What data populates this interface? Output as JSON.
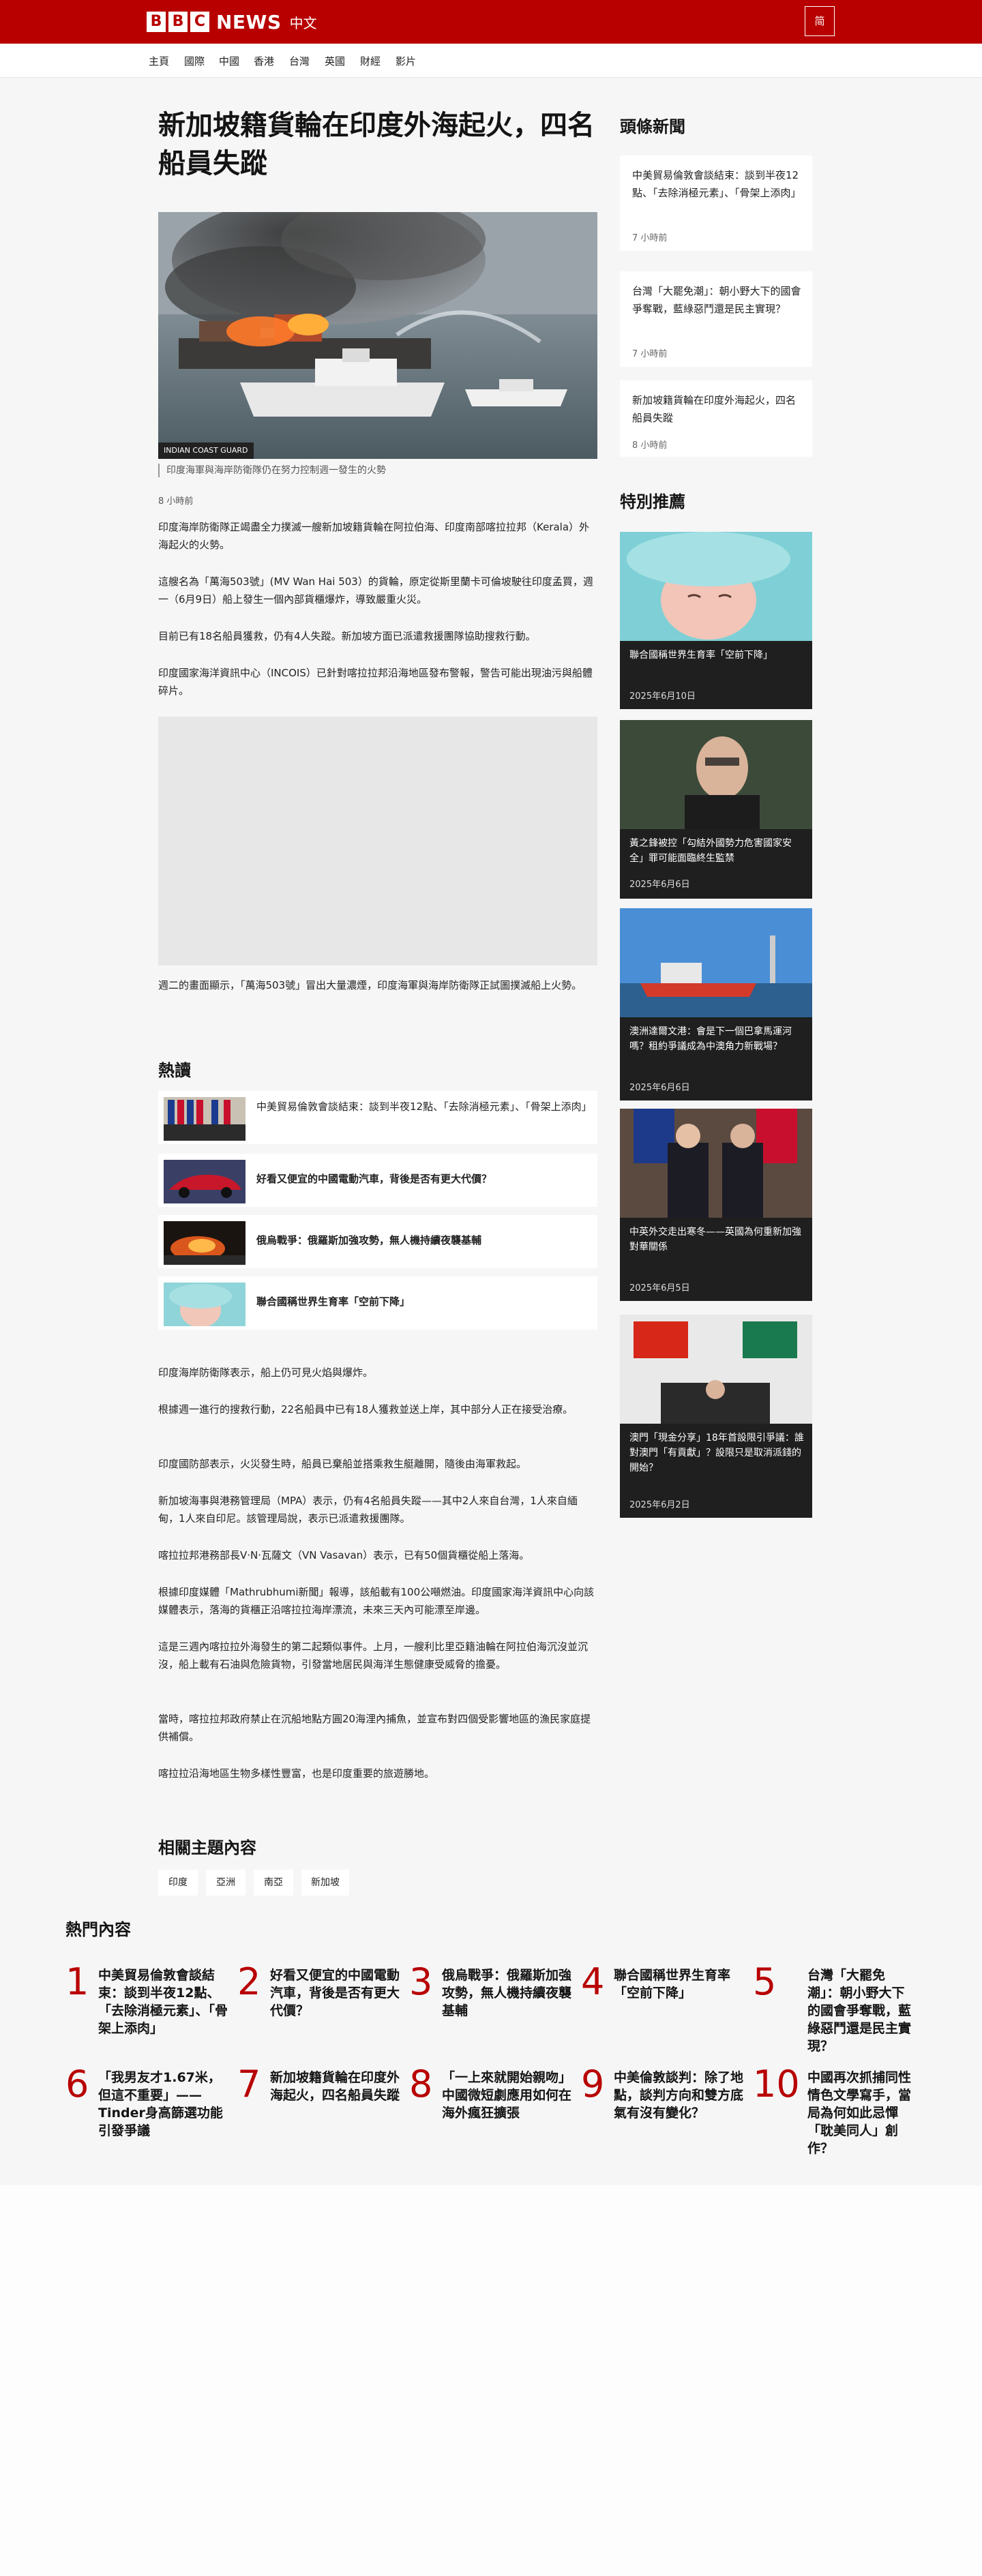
{
  "header": {
    "logo_letters": [
      "B",
      "B",
      "C"
    ],
    "brand": "NEWS",
    "brand_sub": "中文",
    "lang_toggle": "简"
  },
  "nav": [
    "主頁",
    "國際",
    "中國",
    "香港",
    "台灣",
    "英國",
    "財經",
    "影片"
  ],
  "article": {
    "title": "新加坡籍貨輪在印度外海起火，四名船員失蹤",
    "image_credit": "INDIAN COAST GUARD",
    "image_caption": "印度海軍與海岸防衛隊仍在努力控制週一發生的火勢",
    "time": "8 小時前",
    "paragraphs_top": [
      "印度海岸防衛隊正竭盡全力撲滅一艘新加坡籍貨輪在阿拉伯海、印度南部喀拉拉邦（Kerala）外海起火的火勢。",
      "這艘名為「萬海503號」(MV Wan Hai 503）的貨輪，原定從斯里蘭卡可倫坡駛往印度孟買，週一（6月9日）船上發生一個內部貨櫃爆炸，導致嚴重火災。",
      "目前已有18名船員獲救，仍有4人失蹤。新加坡方面已派遣救援團隊協助搜救行動。",
      "印度國家海洋資訊中心（INCOIS）已針對喀拉拉邦沿海地區發布警報，警告可能出現油污與船體碎片。"
    ],
    "video_caption": "週二的畫面顯示，「萬海503號」冒出大量濃煙，印度海軍與海岸防衛隊正試圖撲滅船上火勢。",
    "paragraphs_bottom": [
      "印度海岸防衛隊表示，船上仍可見火焰與爆炸。",
      "根據週一進行的搜救行動，22名船員中已有18人獲救並送上岸，其中部分人正在接受治療。",
      "印度國防部表示，火災發生時，船員已棄船並搭乘救生艇離開，隨後由海軍救起。",
      "新加坡海事與港務管理局（MPA）表示，仍有4名船員失蹤——其中2人來自台灣，1人來自緬甸，1人來自印尼。該管理局說，表示已派遣救援團隊。",
      "喀拉拉邦港務部長V·N·瓦薩文（VN Vasavan）表示，已有50個貨櫃從船上落海。",
      "根據印度媒體「Mathrubhumi新聞」報導，該船載有100公噸燃油。印度國家海洋資訊中心向該媒體表示，落海的貨櫃正沿喀拉拉海岸漂流，未來三天內可能漂至岸邊。",
      "這是三週內喀拉拉外海發生的第二起類似事件。上月，一艘利比里亞籍油輪在阿拉伯海沉沒並沉沒，船上載有石油與危險貨物，引發當地居民與海洋生態健康受威脅的擔憂。",
      "當時，喀拉拉邦政府禁止在沉船地點方圓20海浬內捕魚，並宣布對四個受影響地區的漁民家庭提供補償。",
      "喀拉拉沿海地區生物多樣性豐富，也是印度重要的旅遊勝地。"
    ]
  },
  "popular": {
    "title": "熱讀",
    "items": [
      {
        "text": "中美貿易倫敦會談結束：談到半夜12點、「去除消極元素」、「骨架上添肉」",
        "icon": "flags-image"
      },
      {
        "text": "好看又便宜的中國電動汽車，背後是否有更大代價？",
        "icon": "car-image"
      },
      {
        "text": "俄烏戰爭：俄羅斯加強攻勢，無人機持續夜襲基輔",
        "icon": "fire-image"
      },
      {
        "text": "聯合國稱世界生育率「空前下降」",
        "icon": "baby-image"
      }
    ]
  },
  "related": {
    "title": "相關主題內容",
    "tags": [
      "印度",
      "亞洲",
      "南亞",
      "新加坡"
    ]
  },
  "sidebar": {
    "top_title": "頭條新聞",
    "top_stories": [
      {
        "text": "中美貿易倫敦會談結束：談到半夜12點、「去除消極元素」、「骨架上添肉」",
        "time": "7 小時前"
      },
      {
        "text": "台灣「大罷免潮」：朝小野大下的國會爭奪戰，藍綠惡鬥還是民主實現？",
        "time": "7 小時前"
      },
      {
        "text": "新加坡籍貨輪在印度外海起火，四名船員失蹤",
        "time": "8 小時前"
      }
    ],
    "featured_title": "特別推薦",
    "featured": [
      {
        "text": "聯合國稱世界生育率「空前下降」",
        "date": "2025年6月10日"
      },
      {
        "text": "黃之鋒被控「勾結外國勢力危害國家安全」罪可能面臨終生監禁",
        "date": "2025年6月6日"
      },
      {
        "text": "澳洲達爾文港：會是下一個巴拿馬運河嗎？租約爭議成為中澳角力新戰場？",
        "date": "2025年6月6日"
      },
      {
        "text": "中英外交走出寒冬——英國為何重新加強對華關係",
        "date": "2025年6月5日"
      },
      {
        "text": "澳門「現金分享」18年首設限引爭議：誰對澳門「有貢獻」？設限只是取消派錢的開始？",
        "date": "2025年6月2日"
      }
    ]
  },
  "most_read": {
    "title": "熱門內容",
    "items": [
      {
        "num": "1",
        "text": "中美貿易倫敦會談結束：談到半夜12點、「去除消極元素」、「骨架上添肉」"
      },
      {
        "num": "2",
        "text": "好看又便宜的中國電動汽車，背後是否有更大代價？"
      },
      {
        "num": "3",
        "text": "俄烏戰爭：俄羅斯加強攻勢，無人機持續夜襲基輔"
      },
      {
        "num": "4",
        "text": "聯合國稱世界生育率「空前下降」"
      },
      {
        "num": "5",
        "text": "台灣「大罷免潮」：朝小野大下的國會爭奪戰，藍綠惡鬥還是民主實現？"
      },
      {
        "num": "6",
        "text": "「我男友才1.67米，但這不重要」——Tinder身高篩選功能引發爭議"
      },
      {
        "num": "7",
        "text": "新加坡籍貨輪在印度外海起火，四名船員失蹤"
      },
      {
        "num": "8",
        "text": "「一上來就開始親吻」 中國微短劇應用如何在海外瘋狂擴張"
      },
      {
        "num": "9",
        "text": "中美倫敦談判：除了地點，談判方向和雙方底氣有沒有變化？"
      },
      {
        "num": "10",
        "text": "中國再次抓捕同性情色文學寫手，當局為何如此忌憚「耽美同人」創作？"
      }
    ]
  }
}
